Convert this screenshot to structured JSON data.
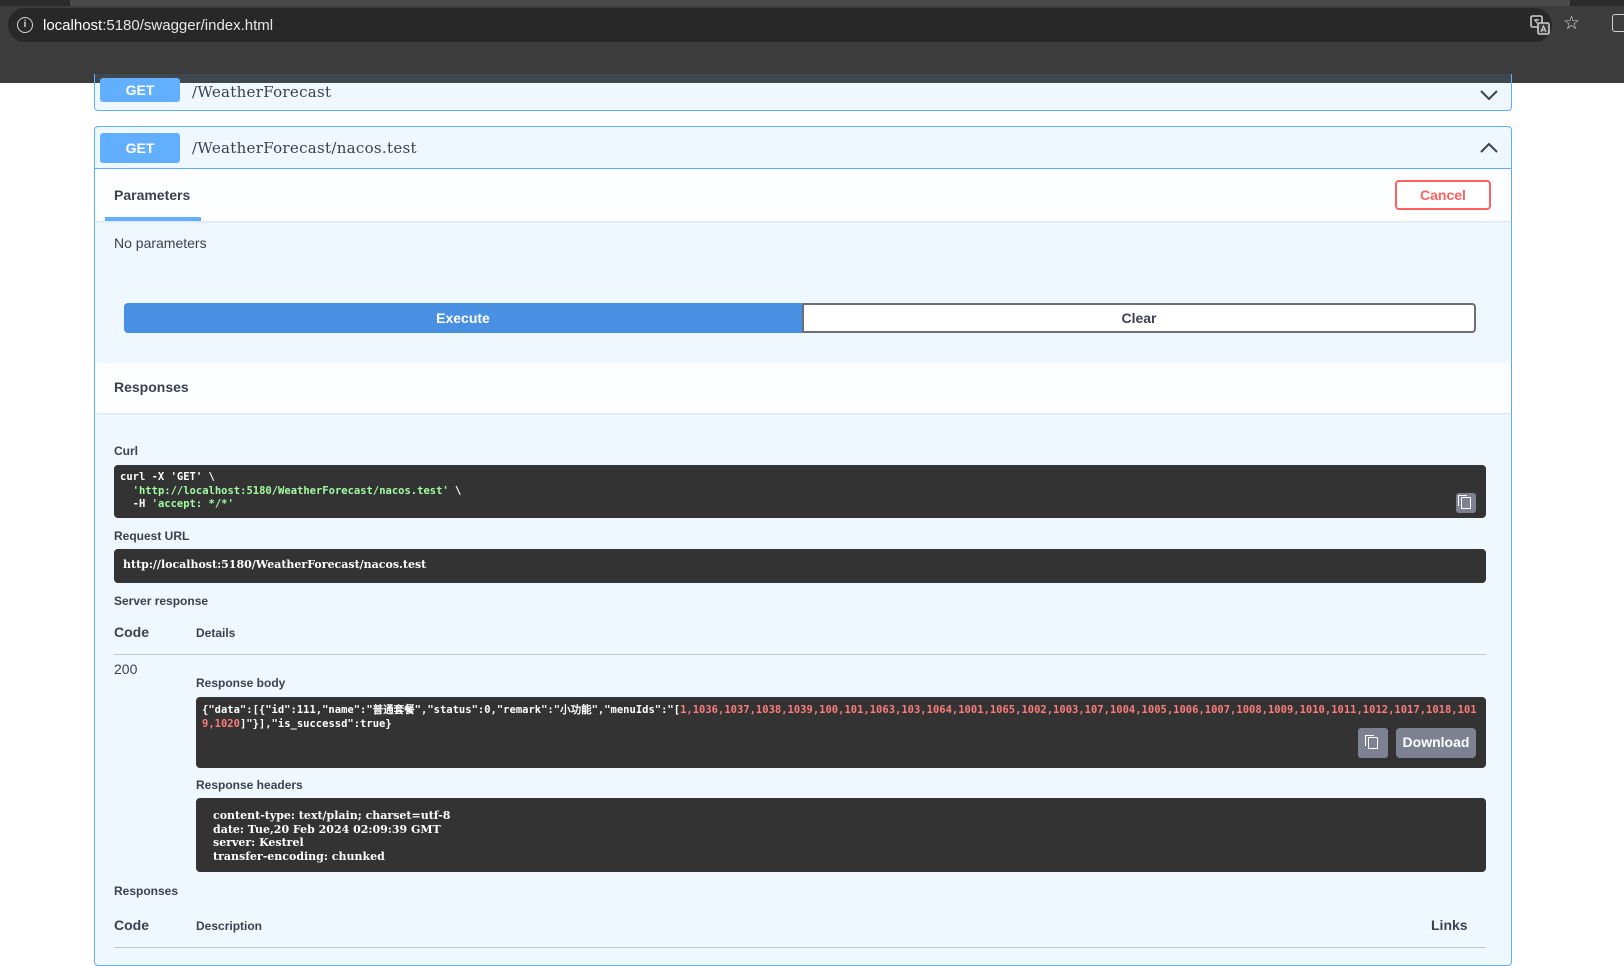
{
  "browser": {
    "url_host": "localhost",
    "url_rest": ":5180/swagger/index.html"
  },
  "operations": [
    {
      "method": "GET",
      "path": "/WeatherForecast"
    },
    {
      "method": "GET",
      "path": "/WeatherForecast/nacos.test"
    }
  ],
  "params_section": {
    "tab_label": "Parameters",
    "cancel_label": "Cancel",
    "no_params": "No parameters",
    "execute_label": "Execute",
    "clear_label": "Clear"
  },
  "responses_title": "Responses",
  "curl": {
    "label": "Curl",
    "line1": "curl -X 'GET' \\",
    "line2_str": "'http://localhost:5180/WeatherForecast/nacos.test'",
    "line2_tail": " \\",
    "line3_prefix": "-H ",
    "line3_str": "'accept: */*'"
  },
  "request_url": {
    "label": "Request URL",
    "value": "http://localhost:5180/WeatherForecast/nacos.test"
  },
  "server_response": {
    "label": "Server response",
    "code_header": "Code",
    "details_header": "Details",
    "code": "200",
    "body_label": "Response body",
    "body_prefix": "{\"data\":[{\"id\":111,\"name\":\"普通套餐\",\"status\":0,\"remark\":\"小功能\",\"menuIds\":\"[",
    "menu_ids": "1,1036,1037,1038,1039,100,101,1063,103,1064,1001,1065,1002,1003,107,1004,1005,1006,1007,1008,1009,1010,1011,1012,1017,1018,1019,1020",
    "body_suffix": "]\"}],\"is_successd\":true}",
    "download_label": "Download",
    "headers_label": "Response headers",
    "headers": [
      "content-type: text/plain; charset=utf-8",
      "date: Tue,20 Feb 2024 02:09:39 GMT",
      "server: Kestrel",
      "transfer-encoding: chunked"
    ]
  },
  "responses_table": {
    "label": "Responses",
    "code_header": "Code",
    "description_header": "Description",
    "links_header": "Links"
  }
}
